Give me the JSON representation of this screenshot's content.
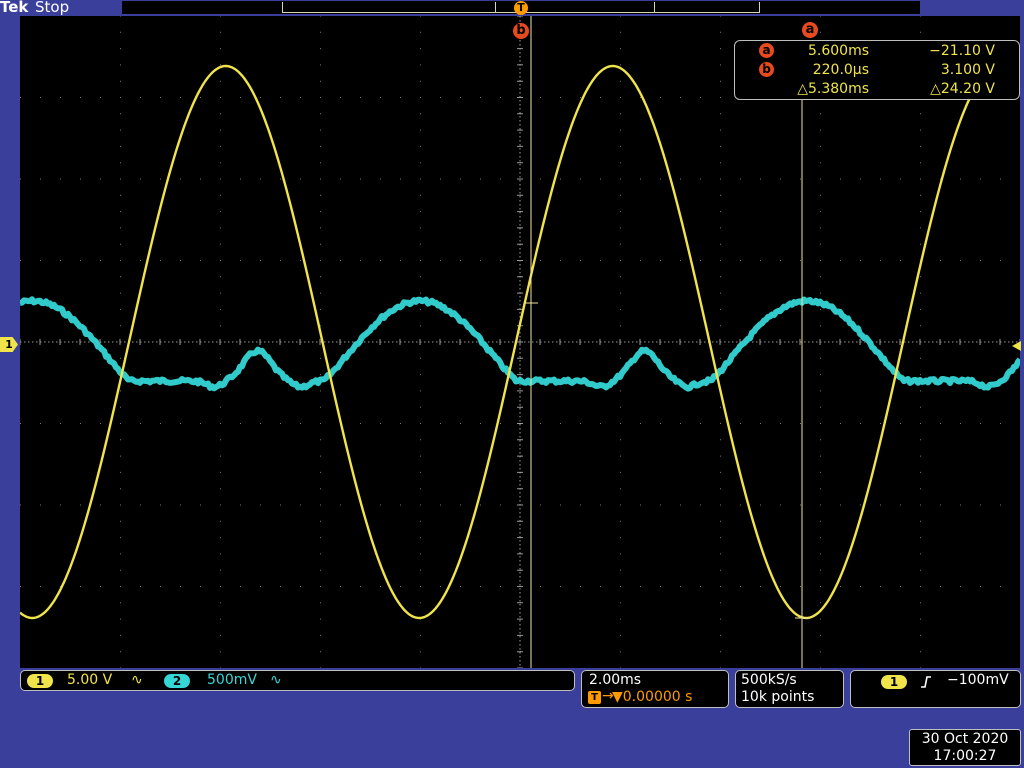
{
  "header": {
    "brand": "Tek",
    "state": "Stop"
  },
  "trigger_marker": "T",
  "cursors": {
    "a": {
      "label": "a",
      "time": "5.600ms",
      "value": "−21.10 V"
    },
    "b": {
      "label": "b",
      "time": "220.0μs",
      "value": "3.100 V"
    },
    "delta": {
      "time": "△5.380ms",
      "value": "△24.20 V"
    }
  },
  "channels": [
    {
      "id": "1",
      "scale": "5.00 V",
      "coupling": "∿",
      "color": "#f0e44a"
    },
    {
      "id": "2",
      "scale": "500mV",
      "coupling": "∿",
      "color": "#35d6d6"
    }
  ],
  "ground_marker": "1",
  "horizontal": {
    "scale": "2.00ms",
    "position_icon": "T",
    "position": "▼0.00000 s"
  },
  "acquisition": {
    "rate": "500kS/s",
    "record_length": "10k points"
  },
  "trigger": {
    "source": "1",
    "slope_icon": "rising-edge",
    "level": "−100mV"
  },
  "datetime": {
    "date": "30 Oct  2020",
    "time": "17:00:27"
  },
  "colors": {
    "ch1": "#f0e44a",
    "ch2": "#35d6d6",
    "cursor_tag": "#e84a1e",
    "frame": "#3a3f9b"
  }
}
